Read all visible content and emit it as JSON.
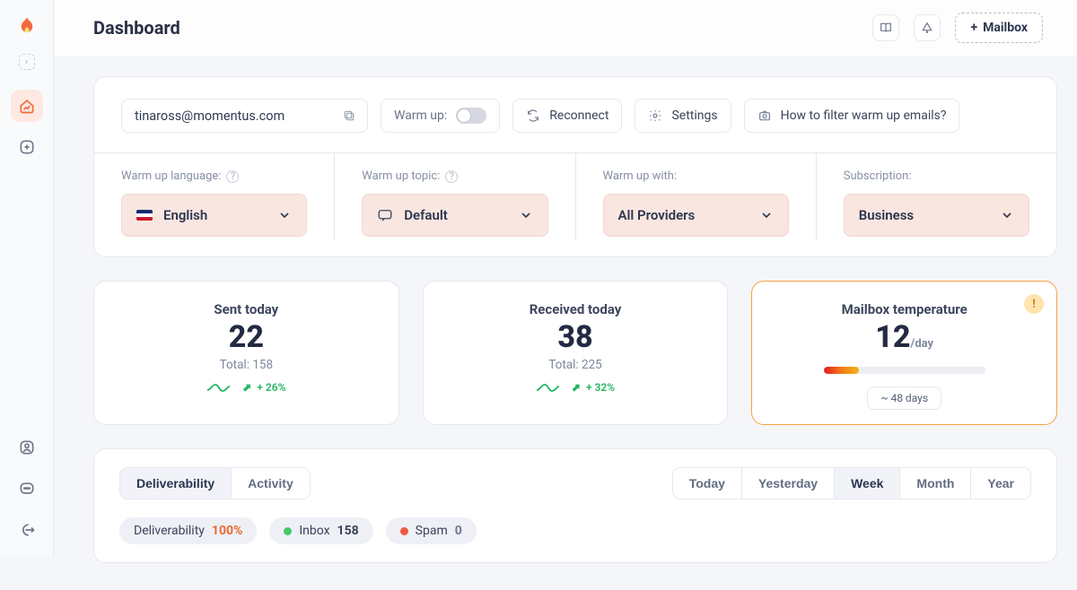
{
  "page_title": "Dashboard",
  "topbar": {
    "mailbox_btn": "Mailbox",
    "mailbox_plus": "+"
  },
  "controls": {
    "email": "tinaross@momentus.com",
    "warmup_label": "Warm up:",
    "reconnect": "Reconnect",
    "settings": "Settings",
    "help_link": "How to filter warm up emails?"
  },
  "selects": {
    "language_label": "Warm up language:",
    "language_value": "English",
    "topic_label": "Warm up topic:",
    "topic_value": "Default",
    "with_label": "Warm up with:",
    "with_value": "All Providers",
    "subscription_label": "Subscription:",
    "subscription_value": "Business"
  },
  "stats": {
    "sent_title": "Sent today",
    "sent_value": "22",
    "sent_total": "Total: 158",
    "sent_trend": "+ 26%",
    "recv_title": "Received today",
    "recv_value": "38",
    "recv_total": "Total: 225",
    "recv_trend": "+ 32%",
    "temp_title": "Mailbox temperature",
    "temp_value": "12",
    "temp_unit": "/day",
    "temp_days": "~ 48 days"
  },
  "tabs": {
    "deliverability": "Deliverability",
    "activity": "Activity"
  },
  "range": {
    "today": "Today",
    "yesterday": "Yesterday",
    "week": "Week",
    "month": "Month",
    "year": "Year"
  },
  "pills": {
    "deliverability_label": "Deliverability",
    "deliverability_value": "100%",
    "inbox_label": "Inbox",
    "inbox_value": "158",
    "spam_label": "Spam",
    "spam_value": "0"
  }
}
